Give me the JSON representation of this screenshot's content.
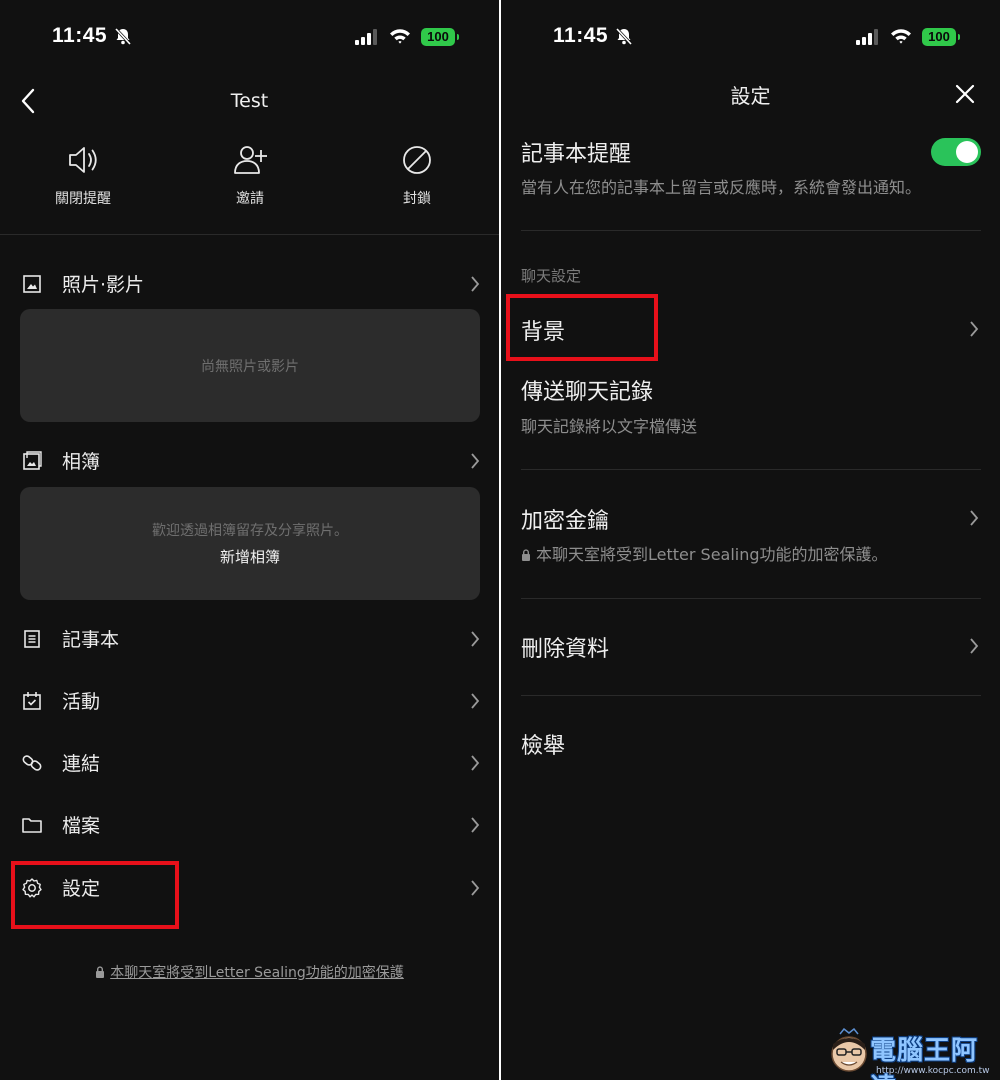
{
  "status": {
    "time": "11:45",
    "battery": "100"
  },
  "left": {
    "title": "Test",
    "actions": [
      {
        "label": "關閉提醒",
        "icon": "speaker-icon"
      },
      {
        "label": "邀請",
        "icon": "add-user-icon"
      },
      {
        "label": "封鎖",
        "icon": "block-icon"
      }
    ],
    "photos": {
      "label": "照片·影片",
      "empty_text": "尚無照片或影片"
    },
    "album": {
      "label": "相簿",
      "prompt": "歡迎透過相簿留存及分享照片。",
      "add_label": "新增相簿"
    },
    "menu": [
      {
        "label": "記事本",
        "icon": "notebook-icon"
      },
      {
        "label": "活動",
        "icon": "calendar-icon"
      },
      {
        "label": "連結",
        "icon": "link-icon"
      },
      {
        "label": "檔案",
        "icon": "folder-icon"
      },
      {
        "label": "設定",
        "icon": "gear-icon"
      }
    ],
    "footer": "本聊天室將受到Letter Sealing功能的加密保護"
  },
  "right": {
    "title": "設定",
    "notebook_reminder": {
      "title": "記事本提醒",
      "description": "當有人在您的記事本上留言或反應時，系統會發出通知。",
      "enabled": true
    },
    "chat_settings_header": "聊天設定",
    "background_label": "背景",
    "export": {
      "title": "傳送聊天記錄",
      "description": "聊天記錄將以文字檔傳送"
    },
    "encryption": {
      "title": "加密金鑰",
      "description": "本聊天室將受到Letter Sealing功能的加密保護。"
    },
    "delete_label": "刪除資料",
    "report_label": "檢舉"
  },
  "colors": {
    "highlight": "#e8101a",
    "toggle_on": "#2ac35a",
    "battery": "#30c94a"
  },
  "watermark": {
    "text": "電腦王阿達",
    "url": "http://www.kocpc.com.tw"
  }
}
